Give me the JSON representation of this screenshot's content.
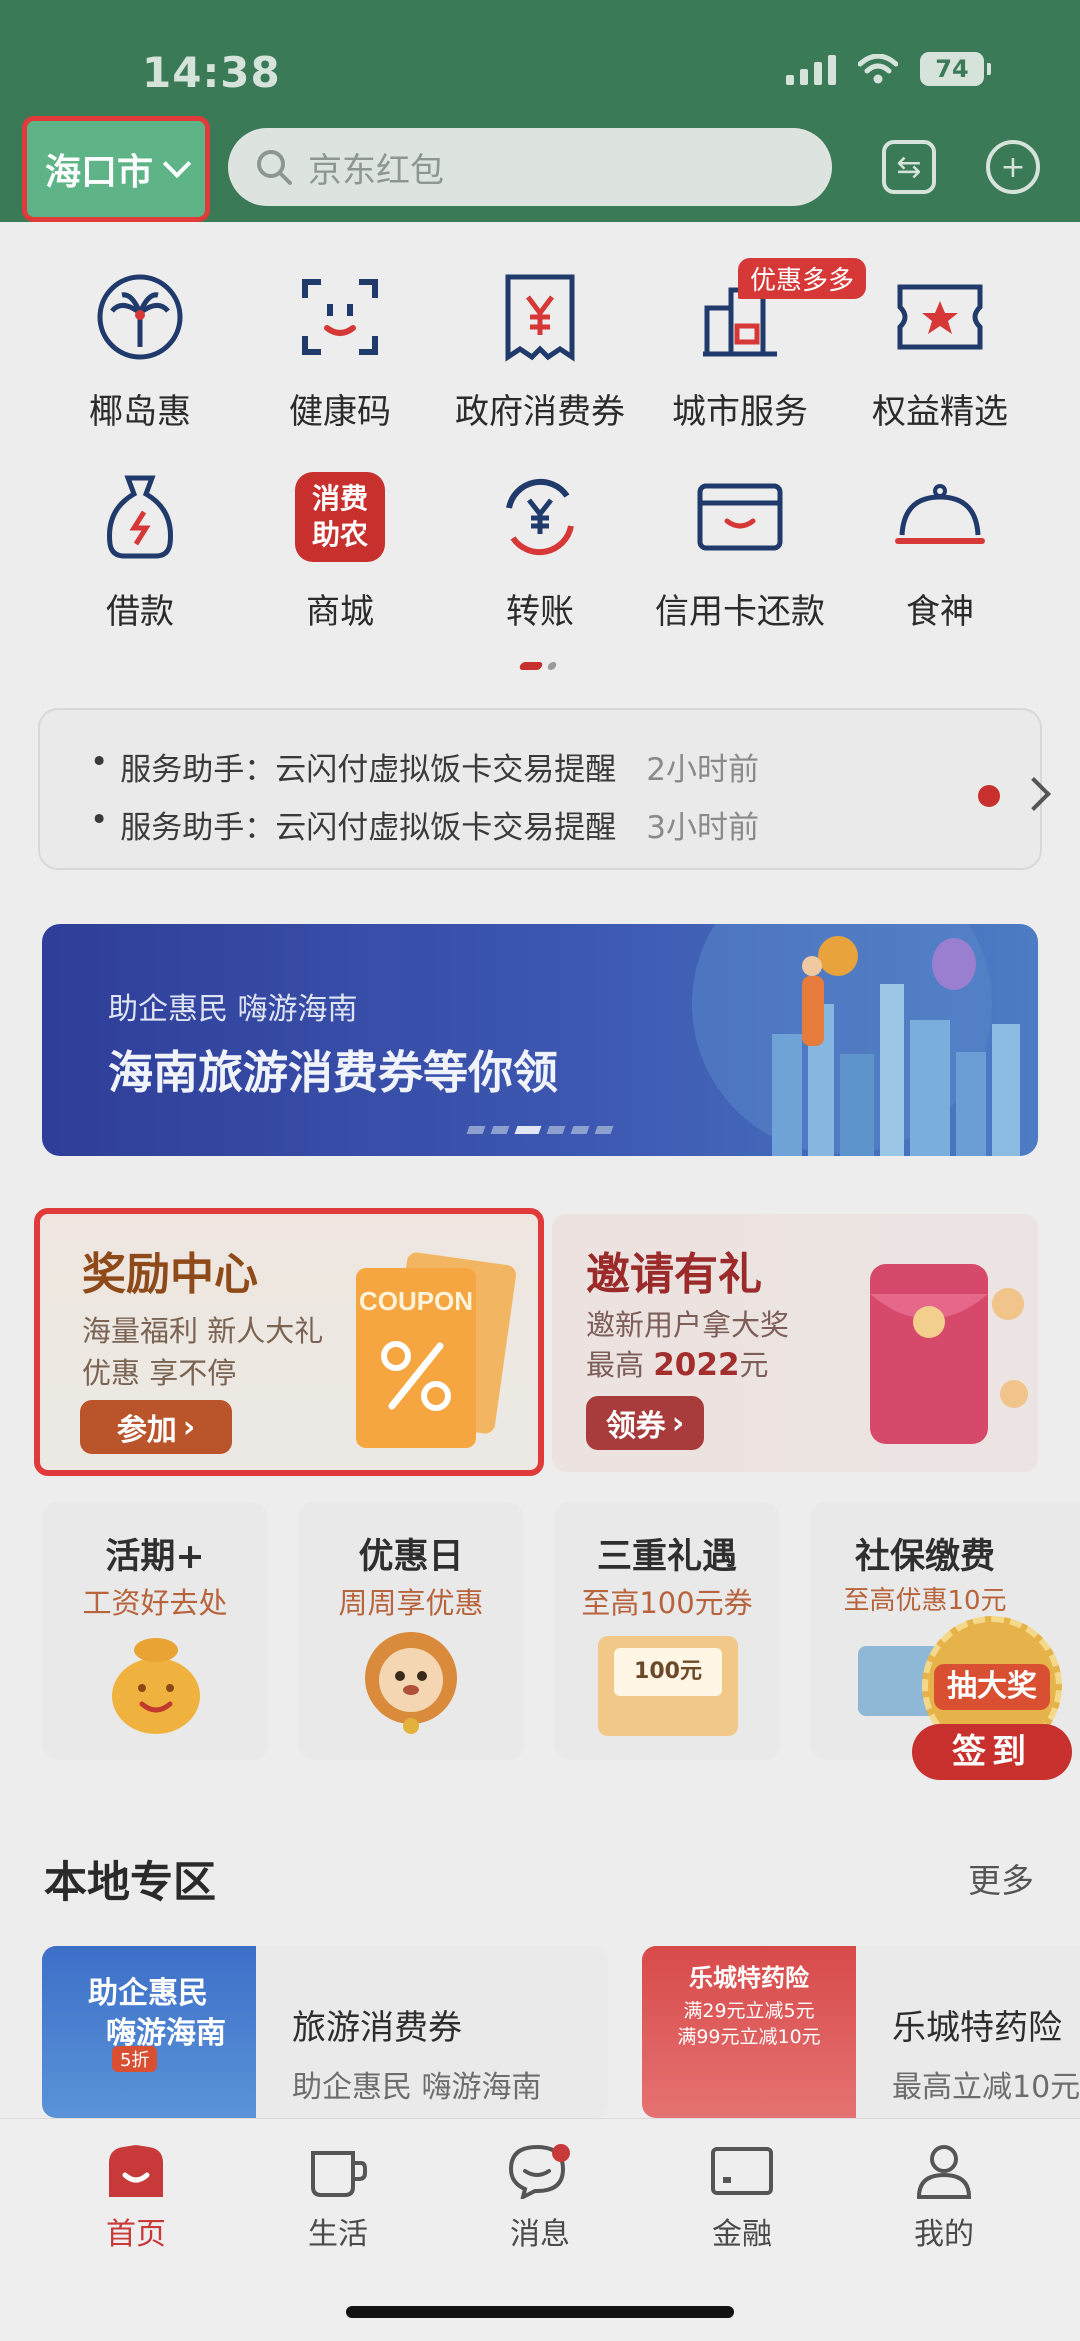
{
  "status_bar": {
    "time": "14:38",
    "battery": "74"
  },
  "header": {
    "city": "海口市",
    "search_placeholder": "京东红包",
    "icons": [
      "scan-switch-icon",
      "plus-circle-icon"
    ]
  },
  "services_row1": [
    {
      "label": "椰岛惠",
      "icon": "palm-tree-icon"
    },
    {
      "label": "健康码",
      "icon": "health-code-icon"
    },
    {
      "label": "政府消费券",
      "icon": "yuan-ticket-icon"
    },
    {
      "label": "城市服务",
      "icon": "city-building-icon",
      "tag": "优惠多多"
    },
    {
      "label": "权益精选",
      "icon": "star-ticket-icon"
    }
  ],
  "services_row2": [
    {
      "label": "借款",
      "icon": "money-bag-icon"
    },
    {
      "label": "商城",
      "icon": "mall-badge-icon",
      "badge_line1": "消费",
      "badge_line2": "助农"
    },
    {
      "label": "转账",
      "icon": "transfer-yuan-icon"
    },
    {
      "label": "信用卡还款",
      "icon": "credit-card-icon"
    },
    {
      "label": "食神",
      "icon": "food-cloche-icon"
    }
  ],
  "notices": [
    {
      "bullet": "•",
      "text": "服务助手：云闪付虚拟饭卡交易提醒",
      "time": "2小时前"
    },
    {
      "bullet": "•",
      "text": "服务助手：云闪付虚拟饭卡交易提醒",
      "time": "3小时前"
    }
  ],
  "banner": {
    "subtitle": "助企惠民  嗨游海南",
    "title": "海南旅游消费券等你领"
  },
  "reward_card": {
    "title": "奖励中心",
    "line1": "海量福利 新人大礼",
    "line2": "优惠 享不停",
    "button": "参加",
    "coupon_text": "COUPON"
  },
  "invite_card": {
    "title": "邀请有礼",
    "line1": "邀新用户拿大奖",
    "line2_prefix": "最高",
    "line2_amount": "2022",
    "line2_suffix": "元",
    "button": "领券"
  },
  "promo_cards": [
    {
      "title": "活期+",
      "subtitle": "工资好去处"
    },
    {
      "title": "优惠日",
      "subtitle": "周周享优惠"
    },
    {
      "title": "三重礼遇",
      "subtitle": "至高100元券",
      "ticket": "100元"
    },
    {
      "title": "社保缴费",
      "subtitle": "至高优惠10元"
    }
  ],
  "lottery": {
    "top": "抽大奖",
    "bottom": "签到"
  },
  "local_section": {
    "title": "本地专区",
    "more": "更多",
    "items": [
      {
        "title": "旅游消费券",
        "subtitle": "助企惠民 嗨游海南",
        "thumb_line1": "助企惠民",
        "thumb_line2": "嗨游海南",
        "thumb_tag": "5折"
      },
      {
        "title": "乐城特药险",
        "subtitle": "最高立减10元",
        "thumb_line1": "乐城特药险",
        "thumb_line2": "满29元立减5元",
        "thumb_line3": "满99元立减10元"
      }
    ]
  },
  "tabbar": [
    {
      "label": "首页",
      "icon": "home-icon",
      "active": true
    },
    {
      "label": "生活",
      "icon": "coffee-cup-icon"
    },
    {
      "label": "消息",
      "icon": "chat-bubble-icon"
    },
    {
      "label": "金融",
      "icon": "card-icon"
    },
    {
      "label": "我的",
      "icon": "user-icon"
    }
  ],
  "colors": {
    "header_green": "#3a7a57",
    "city_green": "#5eb486",
    "brand_red": "#c83a3a",
    "highlight_red": "#e03a3a"
  }
}
